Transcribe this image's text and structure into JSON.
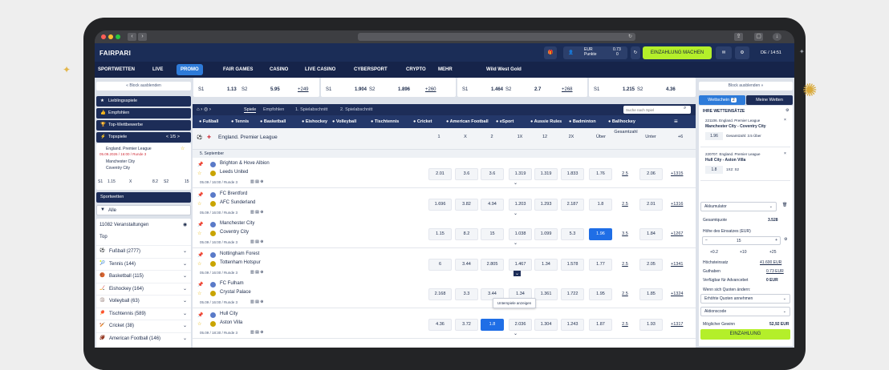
{
  "browser": {
    "refresh": "↻"
  },
  "header": {
    "logo": "FAIRPARI",
    "balance_label": "EUR",
    "balance_value": "0.73",
    "points_label": "Punkte",
    "points_value": "0",
    "deposit": "EINZAHLUNG MACHEN",
    "time": "DE / 14:51"
  },
  "nav": {
    "items": [
      "SPORTWETTEN",
      "LIVE",
      "PROMO",
      "FAIR GAMES",
      "CASINO",
      "LIVE CASINO",
      "CYBERSPORT",
      "CRYPTO",
      "MEHR",
      "Wild West Gold"
    ]
  },
  "left": {
    "block_hide": "« Block ausblenden",
    "favorites": "Lieblingsspiele",
    "recommended": "Empfohlen",
    "top_comp": "Top-Wettbewerbe",
    "top_games": "Topspiele",
    "top_pager": "< 1/5 >",
    "top_match": {
      "league": "England. Premier League",
      "date": "05.09.2026 / 16:00 / Runde 3",
      "team1": "Manchester City",
      "team2": "Coventry City",
      "odds": [
        "S1",
        "1.15",
        "X",
        "8.2",
        "S2",
        "15"
      ]
    },
    "sportwetten": "Sportwetten",
    "filter": "Alle",
    "events": "11082 Veranstaltungen",
    "top": "Top",
    "sports": [
      {
        "name": "Fußball (2777)"
      },
      {
        "name": "Tennis (144)"
      },
      {
        "name": "Basketball (115)"
      },
      {
        "name": "Eishockey (164)"
      },
      {
        "name": "Volleyball (63)"
      },
      {
        "name": "Tischtennis (589)"
      },
      {
        "name": "Cricket (38)"
      },
      {
        "name": "American Football (146)"
      }
    ]
  },
  "topcards": [
    {
      "s1": "S1",
      "v1": "1.13",
      "s2": "S2",
      "v2": "5.95",
      "more": "+249"
    },
    {
      "s1": "S1",
      "v1": "1.904",
      "s2": "S2",
      "v2": "1.896",
      "more": "+260"
    },
    {
      "s1": "S1",
      "v1": "1.464",
      "s2": "S2",
      "v2": "2.7",
      "more": "+268"
    },
    {
      "s1": "S1",
      "v1": "1.215",
      "s2": "S2",
      "v2": "4.36",
      "more": ""
    }
  ],
  "main": {
    "tabs": [
      "Spiele",
      "Empfohlen",
      "1. Spielabschnitt",
      "2. Spielabschnitt"
    ],
    "search_placeholder": "Suche nach Spiel",
    "sports": [
      "Fußball",
      "Tennis",
      "Basketball",
      "Eishockey",
      "Volleyball",
      "Tischtennis",
      "Cricket",
      "American Football",
      "eSport",
      "Aussie Rules",
      "Badminton",
      "Ballhockey"
    ],
    "league": "England. Premier League",
    "columns": [
      "1",
      "X",
      "2",
      "1X",
      "12",
      "2X",
      "Über",
      "Gesamtzahl",
      "Unter",
      "+6"
    ],
    "date": "5. September",
    "matches": [
      {
        "t1": "Brighton & Hove Albion",
        "t2": "Leeds United",
        "meta": "05.09 / 16:00 / Runde 3",
        "odds": [
          "2.01",
          "3.6",
          "3.6",
          "1.319",
          "1.319",
          "1.833",
          "1.76",
          "2.5",
          "2.06"
        ],
        "more": "+1315",
        "sel": -1
      },
      {
        "t1": "FC Brentford",
        "t2": "AFC Sunderland",
        "meta": "05.09 / 16:00 / Runde 3",
        "odds": [
          "1.696",
          "3.82",
          "4.94",
          "1.203",
          "1.293",
          "2.187",
          "1.8",
          "2.5",
          "2.01"
        ],
        "more": "+1316",
        "sel": -1
      },
      {
        "t1": "Manchester City",
        "t2": "Coventry City",
        "meta": "05.09 / 16:00 / Runde 3",
        "odds": [
          "1.15",
          "8.2",
          "15",
          "1.038",
          "1.099",
          "5.3",
          "1.96",
          "3.5",
          "1.84"
        ],
        "more": "+1267",
        "sel": 6
      },
      {
        "t1": "Nottingham Forest",
        "t2": "Tottenham Hotspur",
        "meta": "05.09 / 16:00 / Runde 3",
        "odds": [
          "6",
          "3.44",
          "2.805",
          "1.467",
          "1.34",
          "1.578",
          "1.77",
          "2.5",
          "2.05"
        ],
        "more": "+1341",
        "sel": -1
      },
      {
        "t1": "FC Fulham",
        "t2": "Crystal Palace",
        "meta": "05.09 / 16:00 / Runde 3",
        "odds": [
          "2.168",
          "3.3",
          "3.44",
          "1.34",
          "1.361",
          "1.722",
          "1.95",
          "2.5",
          "1.85"
        ],
        "more": "+1324",
        "sel": -1
      },
      {
        "t1": "Hull City",
        "t2": "Aston Villa",
        "meta": "05.09 / 18:30 / Runde 3",
        "odds": [
          "4.36",
          "3.72",
          "1.8",
          "2.036",
          "1.304",
          "1.243",
          "1.87",
          "2.5",
          "1.93"
        ],
        "more": "+1317",
        "sel": 2
      }
    ],
    "tooltip": "Unterspiele anzeigen"
  },
  "slip": {
    "block_hide": "Block ausblenden »",
    "tab_bets": "Wettschein",
    "tab_count": "2",
    "tab_mine": "Meine Wetten",
    "my_bets": "IHRE WETTEINSÄTZE",
    "bets": [
      {
        "code": "221106. England. Premier League",
        "match": "Manchester City - Coventry City",
        "odd": "1.96",
        "type": "Gesamtzahl: 3.5 Über"
      },
      {
        "code": "220707. England. Premier League",
        "match": "Hull City - Aston Villa",
        "odd": "1.8",
        "type": "1X2: S2"
      }
    ],
    "accumulator": "Akkumulator",
    "total_odds_label": "Gesamtquote",
    "total_odds": "3.528",
    "stake_label": "Höhe des Einsatzes (EUR)",
    "stake": "15",
    "quick": [
      "+0.2",
      "+10",
      "+25"
    ],
    "max_label": "Höchsteinsatz",
    "max_value": "41.600 EUR",
    "credit_label": "Guthaben",
    "credit_value": "0.73 EUR",
    "advance_label": "Verfügbar für Advancebet",
    "advance_value": "0 EUR",
    "change_label": "Wenn sich Quoten ändern:",
    "change_value": "Erhöhte Quoten annehmen",
    "promo_code": "Aktionscode",
    "win_label": "Möglicher Gewinn",
    "win_value": "52,92 EUR",
    "submit": "EINZAHLUNG"
  }
}
